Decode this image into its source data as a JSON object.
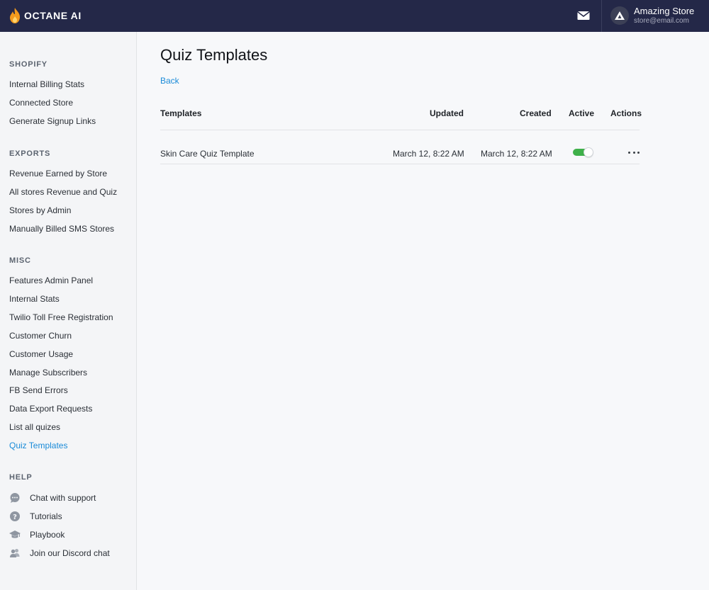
{
  "brand": {
    "name": "OCTANE AI"
  },
  "header": {
    "mail_icon": "envelope-icon",
    "account": {
      "name": "Amazing Store",
      "email": "store@email.com",
      "avatar_icon": "store-logo-icon"
    }
  },
  "sidebar": {
    "sections": [
      {
        "title": "SHOPIFY",
        "items": [
          "Internal Billing Stats",
          "Connected Store",
          "Generate Signup Links"
        ]
      },
      {
        "title": "EXPORTS",
        "items": [
          "Revenue Earned by Store",
          "All stores Revenue and Quiz",
          "Stores by Admin",
          "Manually Billed SMS Stores"
        ]
      },
      {
        "title": "MISC",
        "items": [
          "Features Admin Panel",
          "Internal Stats",
          "Twilio Toll Free Registration",
          "Customer Churn",
          "Customer Usage",
          "Manage Subscribers",
          "FB Send Errors",
          "Data Export Requests",
          "List all quizes",
          "Quiz Templates"
        ]
      }
    ],
    "active_item": "Quiz Templates",
    "help": {
      "title": "HELP",
      "items": [
        {
          "label": "Chat with support",
          "icon": "chat-icon"
        },
        {
          "label": "Tutorials",
          "icon": "question-icon"
        },
        {
          "label": "Playbook",
          "icon": "graduation-cap-icon"
        },
        {
          "label": "Join our Discord chat",
          "icon": "users-icon"
        }
      ]
    }
  },
  "main": {
    "title": "Quiz Templates",
    "back_label": "Back",
    "table": {
      "headers": {
        "templates": "Templates",
        "updated": "Updated",
        "created": "Created",
        "active": "Active",
        "actions": "Actions"
      },
      "rows": [
        {
          "name": "Skin Care Quiz Template",
          "updated": "March 12, 8:22 AM",
          "created": "March 12, 8:22 AM",
          "active": true
        }
      ]
    }
  },
  "colors": {
    "topbar": "#242848",
    "accent": "#1a8bd8",
    "toggle_on": "#3fb04a",
    "logo_flame": "#f39a1c"
  }
}
